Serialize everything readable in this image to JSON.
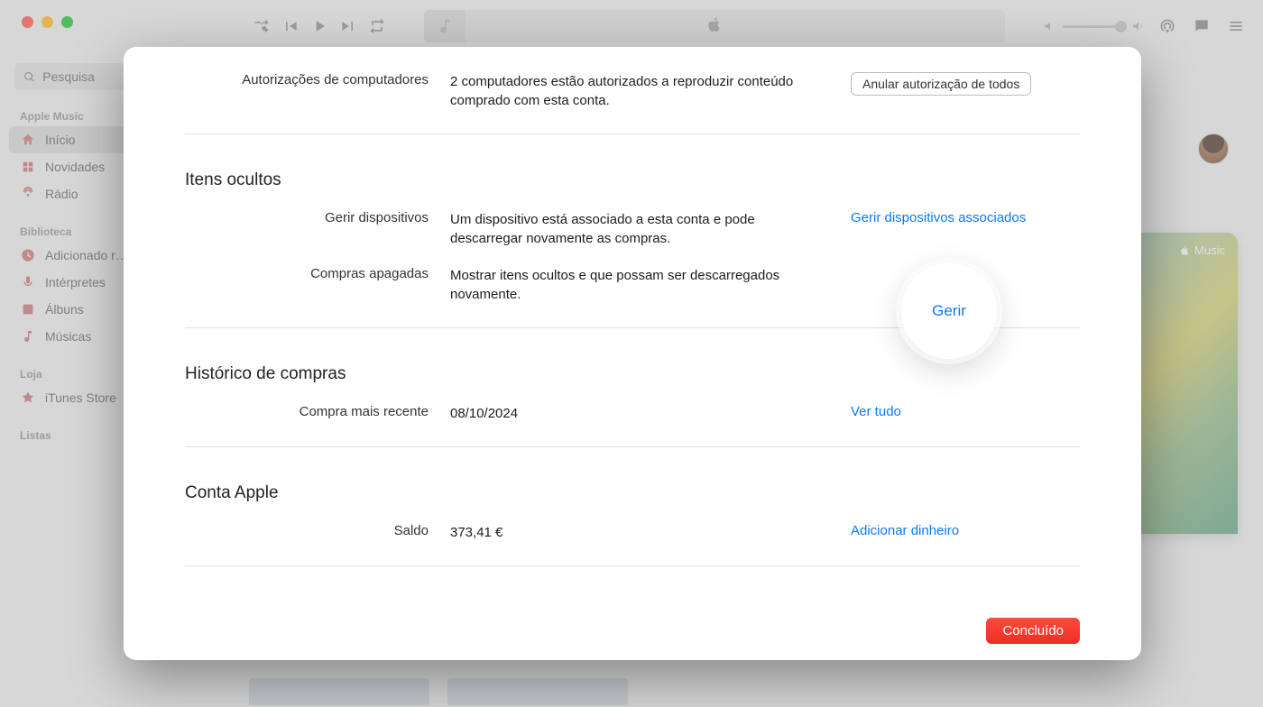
{
  "window": {
    "search_placeholder": "Pesquisa"
  },
  "sidebar": {
    "sections": [
      {
        "title": "Apple Music",
        "items": [
          {
            "label": "Início",
            "icon": "home-icon",
            "active": true
          },
          {
            "label": "Novidades",
            "icon": "grid-icon"
          },
          {
            "label": "Rádio",
            "icon": "radio-icon"
          }
        ]
      },
      {
        "title": "Biblioteca",
        "items": [
          {
            "label": "Adicionado r…",
            "icon": "clock-icon"
          },
          {
            "label": "Intérpretes",
            "icon": "mic-icon"
          },
          {
            "label": "Álbuns",
            "icon": "album-icon"
          },
          {
            "label": "Músicas",
            "icon": "note-icon"
          }
        ]
      },
      {
        "title": "Loja",
        "items": [
          {
            "label": "iTunes Store",
            "icon": "star-icon"
          }
        ]
      },
      {
        "title": "Listas",
        "items": []
      }
    ]
  },
  "promo": {
    "label": "Music"
  },
  "modal": {
    "rows": {
      "computers": {
        "label": "Autorizações de computadores",
        "value": "2 computadores estão autorizados a reproduzir conteúdo comprado com esta conta.",
        "action": "Anular autorização de todos"
      },
      "hidden_title": "Itens ocultos",
      "devices": {
        "label": "Gerir dispositivos",
        "value": "Um dispositivo está associado a esta conta e pode descarregar novamente as compras.",
        "action": "Gerir dispositivos associados"
      },
      "deleted": {
        "label": "Compras apagadas",
        "value": "Mostrar itens ocultos e que possam ser descarregados novamente.",
        "action": "Gerir"
      },
      "history_title": "Histórico de compras",
      "recent": {
        "label": "Compra mais recente",
        "value": "08/10/2024",
        "action": "Ver tudo"
      },
      "account_title": "Conta Apple",
      "balance": {
        "label": "Saldo",
        "value": "373,41 €",
        "action": "Adicionar dinheiro"
      }
    },
    "done": "Concluído"
  }
}
